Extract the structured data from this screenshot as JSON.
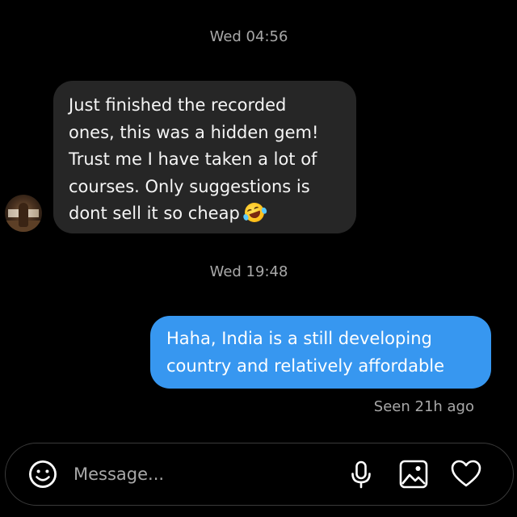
{
  "conversation": {
    "timestamps": [
      "Wed 04:56",
      "Wed 19:48"
    ],
    "incoming_message": {
      "lines": [
        "Just finished the recorded",
        "ones, this was a hidden gem!",
        "Trust me I have taken a lot of",
        "courses. Only suggestions is",
        "dont sell it so cheap"
      ],
      "emoji": "rolling-on-floor-laughing-emoji",
      "sender_avatar": "avatar"
    },
    "outgoing_message": {
      "lines": [
        "Haha, India is a still developing",
        "country and relatively affordable"
      ]
    },
    "seen_status": "Seen 21h ago"
  },
  "composer": {
    "placeholder": "Message...",
    "value": "",
    "icons": [
      "emoji-smile-icon",
      "microphone-icon",
      "gallery-icon",
      "heart-icon"
    ]
  },
  "colors": {
    "background": "#000000",
    "incoming_bubble": "#262626",
    "outgoing_bubble": "#3797f0",
    "secondary_text": "#a8a8a8"
  }
}
